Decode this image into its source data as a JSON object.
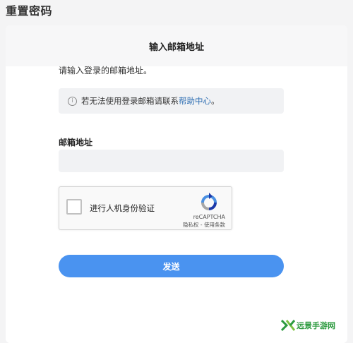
{
  "page": {
    "title": "重置密码"
  },
  "card": {
    "title": "输入邮箱地址",
    "instructions": "请输入登录的邮箱地址。",
    "info": {
      "text": "若无法使用登录邮箱请联系",
      "link": "帮助中心",
      "suffix": "。",
      "icon": "info-icon"
    },
    "email": {
      "label": "邮箱地址",
      "value": "",
      "placeholder": ""
    },
    "recaptcha": {
      "label": "进行人机身份验证",
      "brand": "reCAPTCHA",
      "links": "隐私权 - 使用条款",
      "checked": false
    },
    "submit_label": "发送"
  },
  "watermark": {
    "text": "远景手游网"
  },
  "colors": {
    "accent": "#4a93f0",
    "link": "#2f6fb3",
    "watermark": "#2c9a3f"
  }
}
